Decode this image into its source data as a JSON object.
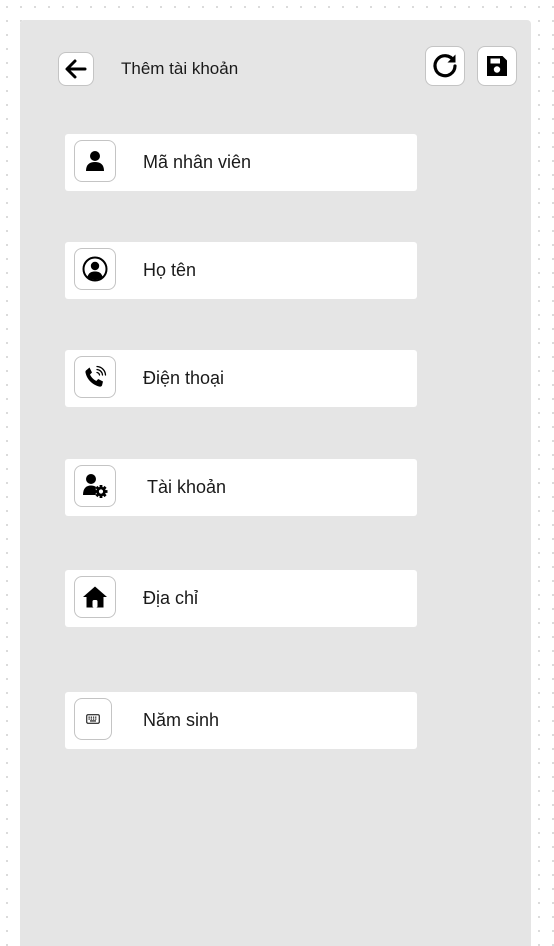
{
  "header": {
    "title": "Thêm tài khoản",
    "back_icon": "arrow-left-icon",
    "reload_icon": "reload-icon",
    "save_icon": "floppy-disk-icon"
  },
  "form": {
    "fields": [
      {
        "label": "Mã nhân viên",
        "icon": "user-icon"
      },
      {
        "label": "Họ tên",
        "icon": "user-circle-icon"
      },
      {
        "label": "Điện thoại",
        "icon": "phone-icon"
      },
      {
        "label": "Tài khoản",
        "icon": "user-gear-icon"
      },
      {
        "label": "Địa chỉ",
        "icon": "home-icon"
      },
      {
        "label": "Năm sinh",
        "icon": "keyboard-icon"
      }
    ]
  },
  "colors": {
    "panel": "#e5e5e5",
    "card": "#ffffff",
    "icon": "#000000",
    "text": "#1a1a1a"
  }
}
